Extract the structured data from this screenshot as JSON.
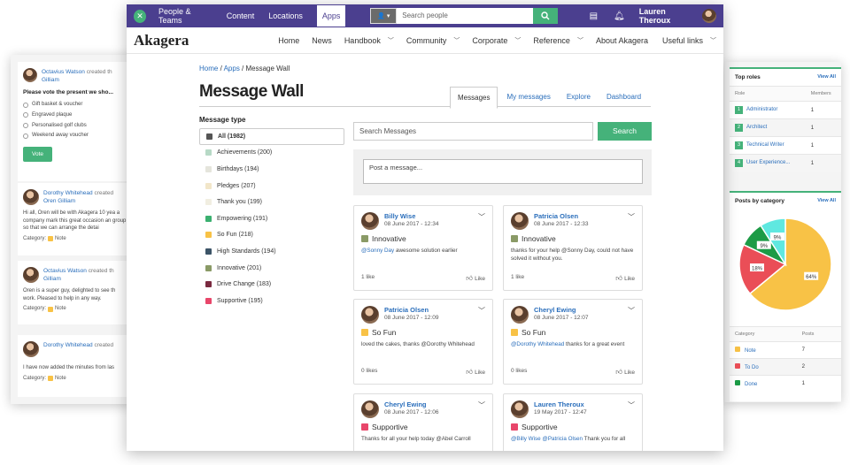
{
  "left_feed": {
    "poll": {
      "author": "Octavius Watson",
      "action": "created th",
      "target": "Gilliam",
      "question": "Please vote the present we sho...",
      "options": [
        "Gift basket & voucher",
        "Engraved plaque",
        "Personalised golf clubs",
        "Weekend away voucher"
      ],
      "vote_label": "Vote"
    },
    "posts": [
      {
        "author": "Dorothy Whitehead",
        "action": "created",
        "target": "Oren Gilliam",
        "text": "Hi all, Oren will be with Akagera 10 yea a company mark this great occasion an group so that we can arrange the detai",
        "category_label": "Category:",
        "category": "Note"
      },
      {
        "author": "Octavius Watson",
        "action": "created th",
        "target": "Gilliam",
        "text": "Oren is a super guy, delighted to see th work. Pleased to help in any way.",
        "category_label": "Category:",
        "category": "Note"
      },
      {
        "author": "Dorothy Whitehead",
        "action": "created",
        "target": "",
        "text": "I have now added the minutes from las",
        "category_label": "Category:",
        "category": "Note"
      }
    ]
  },
  "right_panel": {
    "top_roles": {
      "title": "Top roles",
      "view_all": "View All",
      "headers": [
        "Role",
        "Members"
      ],
      "rows": [
        {
          "rank": "1",
          "role": "Administrator",
          "members": "1"
        },
        {
          "rank": "2",
          "role": "Architect",
          "members": "1"
        },
        {
          "rank": "3",
          "role": "Technical Writer",
          "members": "1"
        },
        {
          "rank": "4",
          "role": "User Experience...",
          "members": "1"
        }
      ]
    },
    "posts_by_category": {
      "title": "Posts by category",
      "view_all": "View All",
      "headers": [
        "Category",
        "Posts"
      ],
      "rows": [
        {
          "name": "Note",
          "color": "#f8c246",
          "posts": "7"
        },
        {
          "name": "To Do",
          "color": "#ea4e57",
          "posts": "2"
        },
        {
          "name": "Done",
          "color": "#1c9b46",
          "posts": "1"
        }
      ]
    }
  },
  "chart_data": {
    "type": "pie",
    "slices": [
      {
        "label": "64%",
        "value": 64,
        "color": "#f8c246"
      },
      {
        "label": "18%",
        "value": 18,
        "color": "#ea4e57"
      },
      {
        "label": "9%",
        "value": 9,
        "color": "#1c9b46"
      },
      {
        "label": "9%",
        "value": 9,
        "color": "#5fe8e0"
      }
    ]
  },
  "topbar": {
    "nav": [
      "People & Teams",
      "Content",
      "Locations",
      "Apps"
    ],
    "active": "Apps",
    "search_placeholder": "Search people",
    "user_name": "Lauren Theroux"
  },
  "secondbar": {
    "brand": "Akagera",
    "nav": [
      "Home",
      "News",
      "Handbook",
      "Community",
      "Corporate",
      "Reference",
      "About Akagera",
      "Useful links"
    ]
  },
  "breadcrumb": {
    "home": "Home",
    "sep1": " / ",
    "apps": "Apps",
    "sep2": " / ",
    "current": "Message Wall"
  },
  "page_title": "Message Wall",
  "tabs": [
    "Messages",
    "My messages",
    "Explore",
    "Dashboard"
  ],
  "message_types": {
    "title": "Message type",
    "items": [
      {
        "label": "All (1982)",
        "color": "#555555"
      },
      {
        "label": "Achievements (200)",
        "color": "#b7d9c6"
      },
      {
        "label": "Birthdays (194)",
        "color": "#e5e5dc"
      },
      {
        "label": "Pledges (207)",
        "color": "#f2e6c9"
      },
      {
        "label": "Thank you (199)",
        "color": "#f1eee1"
      },
      {
        "label": "Empowering (191)",
        "color": "#3bb070"
      },
      {
        "label": "So Fun (218)",
        "color": "#f8c246"
      },
      {
        "label": "High Standards (194)",
        "color": "#3c5467"
      },
      {
        "label": "Innovative (201)",
        "color": "#8a9a66"
      },
      {
        "label": "Drive Change (183)",
        "color": "#7a2a40"
      },
      {
        "label": "Supportive (195)",
        "color": "#e8466a"
      }
    ]
  },
  "messages_search": {
    "placeholder": "Search Messages",
    "button": "Search"
  },
  "post_box": {
    "placeholder": "Post a message..."
  },
  "cards": [
    {
      "name": "Billy Wise",
      "date": "08 June 2017 - 12:34",
      "type": "Innovative",
      "color": "#8a9a66",
      "mention": "@Sonny Day",
      "text": " awesome solution earlier",
      "likes": "1 like",
      "like_label": "Like"
    },
    {
      "name": "Patricia Olsen",
      "date": "08 June 2017 - 12:33",
      "type": "Innovative",
      "color": "#8a9a66",
      "mention": "",
      "text": "thanks for your help @Sonny Day, could not have solved it without you.",
      "likes": "1 like",
      "like_label": "Like"
    },
    {
      "name": "Patricia Olsen",
      "date": "08 June 2017 - 12:09",
      "type": "So Fun",
      "color": "#f8c246",
      "mention": "",
      "text": "loved the cakes, thanks @Dorothy Whitehead",
      "likes": "0 likes",
      "like_label": "Like"
    },
    {
      "name": "Cheryl Ewing",
      "date": "08 June 2017 - 12:07",
      "type": "So Fun",
      "color": "#f8c246",
      "mention": "@Dorothy Whitehead",
      "text": " thanks for a great event",
      "likes": "0 likes",
      "like_label": "Like"
    },
    {
      "name": "Cheryl Ewing",
      "date": "08 June 2017 - 12:06",
      "type": "Supportive",
      "color": "#e8466a",
      "mention": "",
      "text": "Thanks for all your help today @Abel Carroll",
      "likes": "",
      "like_label": ""
    },
    {
      "name": "Lauren Theroux",
      "date": "19 May 2017 - 12:47",
      "type": "Supportive",
      "color": "#e8466a",
      "mention": "@Billy Wise @Patricia Olsen",
      "text": " Thank you for all",
      "likes": "",
      "like_label": ""
    }
  ]
}
